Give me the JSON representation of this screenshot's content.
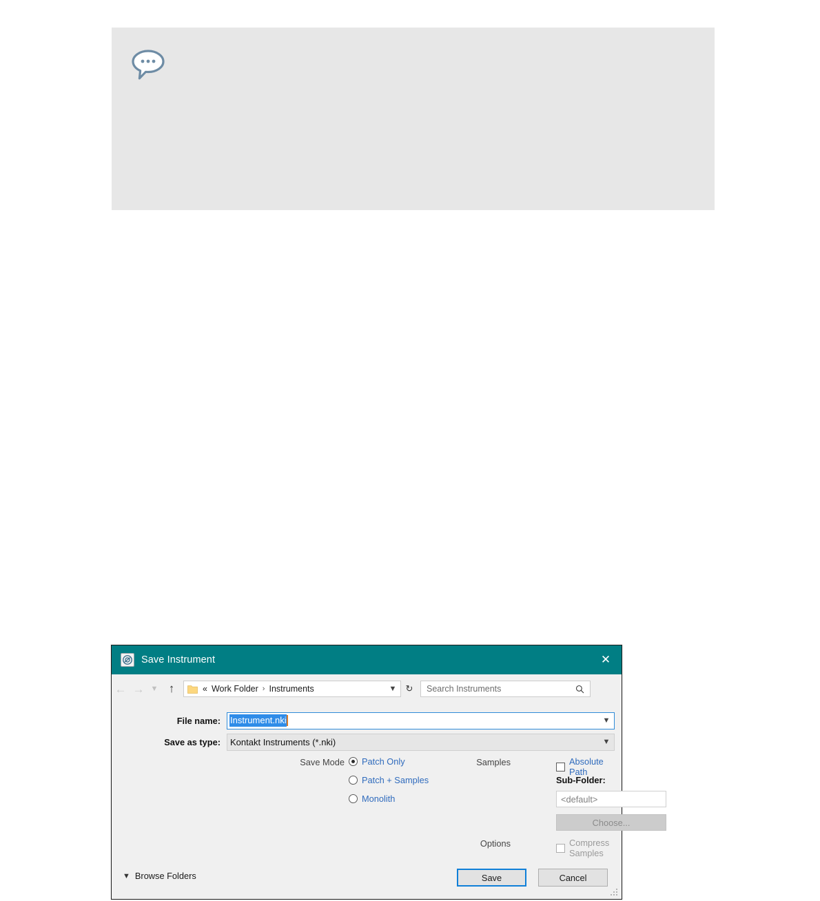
{
  "comment_panel": {
    "icon": "speech-bubble-icon",
    "text": ""
  },
  "dialog": {
    "title": "Save Instrument",
    "title_icon": "kontakt-app-icon",
    "close_icon": "close-icon",
    "accent_color": "#017e84",
    "link_color": "#2f6bbd",
    "nav": {
      "back_icon": "back-arrow-icon",
      "forward_icon": "forward-arrow-icon",
      "recent_icon": "recent-locations-icon",
      "up_icon": "up-arrow-icon",
      "folder_icon": "folder-icon",
      "breadcrumb_prefix": "«",
      "breadcrumb": [
        "Work Folder",
        "Instruments"
      ],
      "breadcrumb_separator": "›",
      "dropdown_icon": "chevron-down-icon",
      "refresh_icon": "refresh-icon"
    },
    "search": {
      "placeholder": "Search Instruments",
      "icon": "search-icon"
    },
    "filename": {
      "label": "File name:",
      "value": "Instrument.nki",
      "dropdown_icon": "chevron-down-icon"
    },
    "savetype": {
      "label": "Save as type:",
      "value": "Kontakt Instruments (*.nki)",
      "dropdown_icon": "chevron-down-icon"
    },
    "save_mode": {
      "label": "Save Mode",
      "options": [
        {
          "label": "Patch Only",
          "checked": true
        },
        {
          "label": "Patch + Samples",
          "checked": false
        },
        {
          "label": "Monolith",
          "checked": false
        }
      ]
    },
    "samples": {
      "label": "Samples",
      "absolute_path": {
        "label": "Absolute Path",
        "checked": false
      },
      "subfolder_label": "Sub-Folder:",
      "subfolder_value": "<default>",
      "choose_button": "Choose..."
    },
    "options": {
      "label": "Options",
      "compress_samples": {
        "label": "Compress Samples",
        "checked": false
      }
    },
    "footer": {
      "browse_folders": "Browse Folders",
      "browse_chevron_icon": "chevron-down-icon",
      "save_label": "Save",
      "cancel_label": "Cancel",
      "resize_grip_icon": "resize-grip-icon"
    }
  }
}
